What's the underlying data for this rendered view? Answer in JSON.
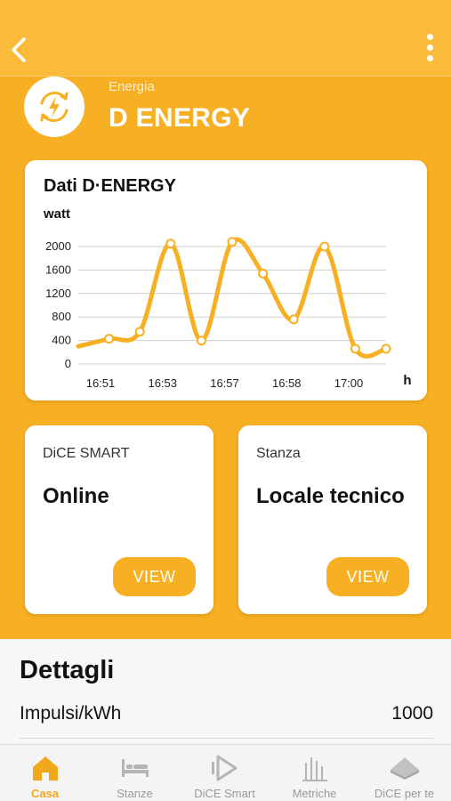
{
  "header": {
    "category": "Energia",
    "title": "D ENERGY",
    "accent_color": "#f7b023"
  },
  "chart_data": {
    "type": "line",
    "title": "Dati D·ENERGY",
    "ylabel": "watt",
    "xlabel": "h",
    "x_ticks": [
      "16:51",
      "16:53",
      "16:57",
      "16:58",
      "17:00"
    ],
    "y_ticks": [
      0,
      400,
      800,
      1200,
      1600,
      2000
    ],
    "ylim": [
      0,
      2000
    ],
    "points": [
      {
        "x": 0,
        "y": 300
      },
      {
        "x": 1,
        "y": 430
      },
      {
        "x": 2,
        "y": 550
      },
      {
        "x": 3,
        "y": 2050
      },
      {
        "x": 4,
        "y": 400
      },
      {
        "x": 5,
        "y": 2080
      },
      {
        "x": 6,
        "y": 1540
      },
      {
        "x": 7,
        "y": 760
      },
      {
        "x": 8,
        "y": 2000
      },
      {
        "x": 9,
        "y": 260
      },
      {
        "x": 10,
        "y": 260
      }
    ],
    "grid": true,
    "line_color": "#f7b023"
  },
  "cards": [
    {
      "label": "DiCE SMART",
      "value": "Online",
      "button": "VIEW"
    },
    {
      "label": "Stanza",
      "value": "Locale tecnico",
      "button": "VIEW"
    }
  ],
  "details": {
    "title": "Dettagli",
    "rows": [
      {
        "key": "Impulsi/kWh",
        "value": "1000"
      }
    ]
  },
  "tabs": [
    {
      "label": "Casa",
      "icon": "home-icon",
      "active": true
    },
    {
      "label": "Stanze",
      "icon": "bed-icon",
      "active": false
    },
    {
      "label": "DiCE Smart",
      "icon": "dice-smart-icon",
      "active": false
    },
    {
      "label": "Metriche",
      "icon": "metrics-icon",
      "active": false
    },
    {
      "label": "DiCE per te",
      "icon": "dice-per-te-icon",
      "active": false
    }
  ]
}
